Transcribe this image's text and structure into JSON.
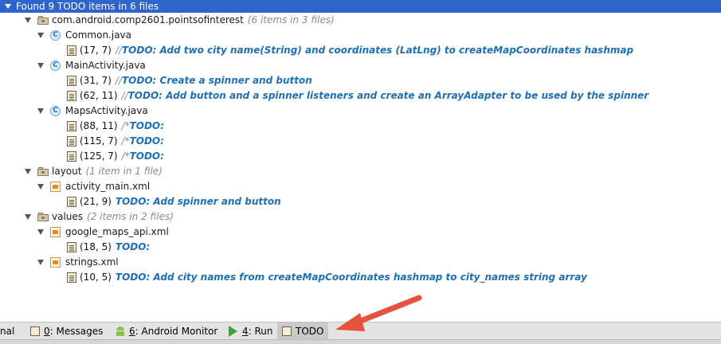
{
  "header": {
    "title": "Found 9 TODO items in 6 files"
  },
  "tree": {
    "package": {
      "name": "com.android.comp2601.pointsofinterest",
      "count": "(6 items in 3 files)"
    },
    "common": {
      "name": "Common.java",
      "items": [
        {
          "pos": "(17, 7)",
          "cmt": "//",
          "todo": "TODO: Add two city name(String) and coordinates (LatLng) to createMapCoordinates hashmap"
        }
      ]
    },
    "main": {
      "name": "MainActivity.java",
      "items": [
        {
          "pos": "(31, 7)",
          "cmt": "//",
          "todo": "TODO: Create a spinner and button"
        },
        {
          "pos": "(62, 11)",
          "cmt": "//",
          "todo": "TODO: Add button and a spinner listeners and create an ArrayAdapter to be used by the spinner"
        }
      ]
    },
    "maps": {
      "name": "MapsActivity.java",
      "items": [
        {
          "pos": "(88, 11)",
          "cmt": "/*",
          "todo": "TODO:"
        },
        {
          "pos": "(115, 7)",
          "cmt": "/*",
          "todo": "TODO:"
        },
        {
          "pos": "(125, 7)",
          "cmt": "/*",
          "todo": "TODO:"
        }
      ]
    },
    "layout": {
      "name": "layout",
      "count": "(1 item in 1 file)"
    },
    "activity_main": {
      "name": "activity_main.xml",
      "items": [
        {
          "pos": "(21, 9)",
          "todo": "TODO: Add spinner and button"
        }
      ]
    },
    "values": {
      "name": "values",
      "count": "(2 items in 2 files)"
    },
    "google_maps": {
      "name": "google_maps_api.xml",
      "items": [
        {
          "pos": "(18, 5)",
          "todo": "TODO:"
        }
      ]
    },
    "strings": {
      "name": "strings.xml",
      "items": [
        {
          "pos": "(10, 5)",
          "todo": "TODO: Add city names from createMapCoordinates hashmap to city_names string array"
        }
      ]
    }
  },
  "toolbar": {
    "terminal": "nal",
    "messages_key": "0",
    "messages": ": Messages",
    "monitor_key": "6",
    "monitor": ": Android Monitor",
    "run_key": "4",
    "run": ": Run",
    "todo": "TODO"
  },
  "colors": {
    "header_bg": "#2f65ca",
    "todo_text": "#1f6fb3",
    "arrow": "#e5533d"
  }
}
